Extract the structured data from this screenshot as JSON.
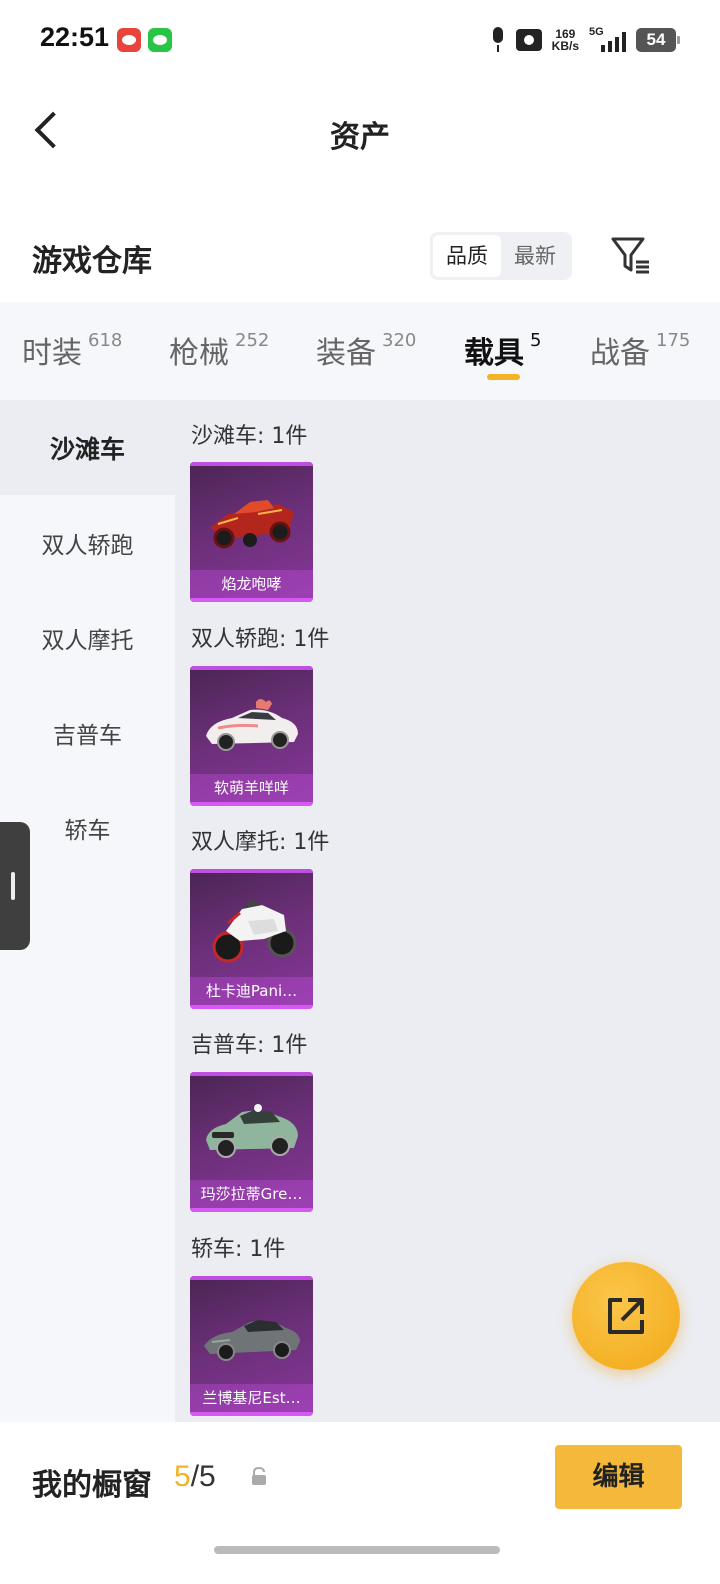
{
  "status_bar": {
    "time": "22:51",
    "net_speed_value": "169",
    "net_speed_unit": "KB/s",
    "network": "5G",
    "battery": "54"
  },
  "header": {
    "title": "资产"
  },
  "warehouse": {
    "title": "游戏仓库",
    "sort_options": [
      "品质",
      "最新"
    ],
    "active_sort": "品质"
  },
  "tabs": [
    {
      "label": "时装",
      "count": "618"
    },
    {
      "label": "枪械",
      "count": "252"
    },
    {
      "label": "装备",
      "count": "320"
    },
    {
      "label": "载具",
      "count": "5"
    },
    {
      "label": "战备",
      "count": "175"
    }
  ],
  "active_tab": "载具",
  "sidebar": {
    "items": [
      "沙滩车",
      "双人轿跑",
      "双人摩托",
      "吉普车",
      "轿车"
    ],
    "active": "沙滩车"
  },
  "groups": [
    {
      "title": "沙滩车: 1件",
      "item_name": "焰龙咆哮",
      "icon": "buggy-icon"
    },
    {
      "title": "双人轿跑: 1件",
      "item_name": "软萌羊咩咩",
      "icon": "coupe-icon"
    },
    {
      "title": "双人摩托: 1件",
      "item_name": "杜卡迪Pani…",
      "icon": "motorcycle-icon"
    },
    {
      "title": "吉普车: 1件",
      "item_name": "玛莎拉蒂Gre…",
      "icon": "suv-icon"
    },
    {
      "title": "轿车: 1件",
      "item_name": "兰博基尼Est…",
      "icon": "sedan-icon"
    }
  ],
  "bottom_bar": {
    "window_label": "我的橱窗",
    "window_current": "5",
    "window_total": "/5",
    "edit_label": "编辑"
  },
  "colors": {
    "accent": "#f4b325",
    "card_purple": "#6b2f78"
  }
}
